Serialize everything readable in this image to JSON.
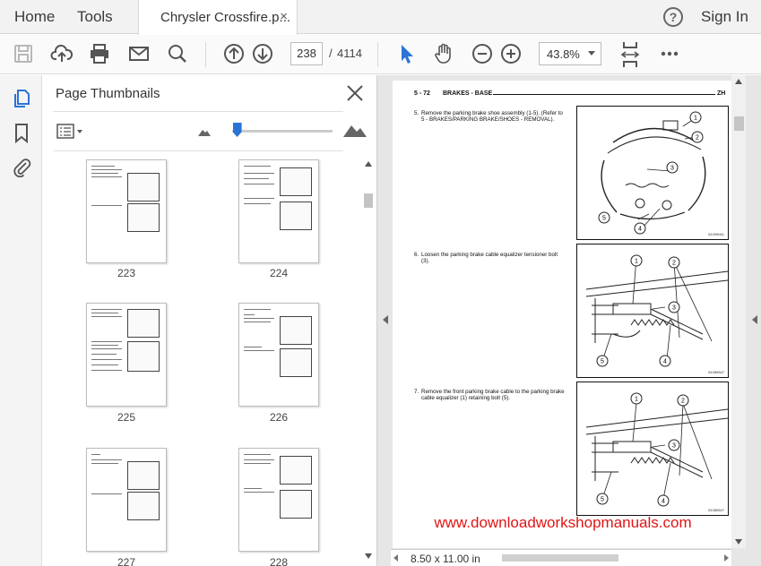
{
  "tabbar": {
    "home_label": "Home",
    "tools_label": "Tools",
    "document_tab": "Chrysler Crossfire.p...",
    "close_tab": "×",
    "help_symbol": "?",
    "signin_label": "Sign In"
  },
  "toolbar": {
    "icons": [
      "save-icon",
      "cloud-upload-icon",
      "print-icon",
      "email-icon",
      "search-icon",
      "previous-page-icon",
      "next-page-icon",
      "select-arrow-icon",
      "hand-tool-icon",
      "zoom-out-icon",
      "zoom-in-icon",
      "page-fit-icon",
      "more-icon"
    ],
    "current_page": "238",
    "page_separator": "/",
    "total_pages": "4114",
    "zoom": "43.8%",
    "accent_color": "#2a74d6"
  },
  "rail": {
    "icons": [
      "page-thumbnails-icon",
      "bookmarks-icon",
      "attachments-icon"
    ]
  },
  "thumbnails_panel": {
    "title": "Page Thumbnails",
    "slider_level": 0.05,
    "pages": [
      {
        "label": "223"
      },
      {
        "label": "224"
      },
      {
        "label": "225"
      },
      {
        "label": "226"
      },
      {
        "label": "227"
      },
      {
        "label": "228"
      }
    ]
  },
  "document": {
    "header_section": "5 - 72",
    "header_title": "BRAKES - BASE",
    "header_model": "ZH",
    "steps": [
      {
        "num": "5.",
        "text": "Remove the parking brake shoe assembly (1-5). (Refer to 5 - BRAKES/PARKING BRAKE/SHOES - REMOVAL)."
      },
      {
        "num": "6.",
        "text": "Loosen the parking brake cable equalizer tensioner bolt (3)."
      },
      {
        "num": "7.",
        "text": "Remove the front parking brake cable to the parking brake cable equalizer (1) retaining bolt (5)."
      }
    ],
    "figures": [
      {
        "code": "81099b61",
        "callouts": [
          "1",
          "2",
          "3",
          "4",
          "5"
        ]
      },
      {
        "code": "81085847",
        "callouts": [
          "1",
          "2",
          "3",
          "4",
          "5"
        ]
      },
      {
        "code": "81085847",
        "callouts": [
          "1",
          "2",
          "3",
          "4",
          "5"
        ]
      }
    ],
    "watermark": "www.downloadworkshopmanuals.com",
    "watermark_color": "#e01414"
  },
  "statusbar": {
    "page_size": "8.50 x 11.00 in"
  }
}
